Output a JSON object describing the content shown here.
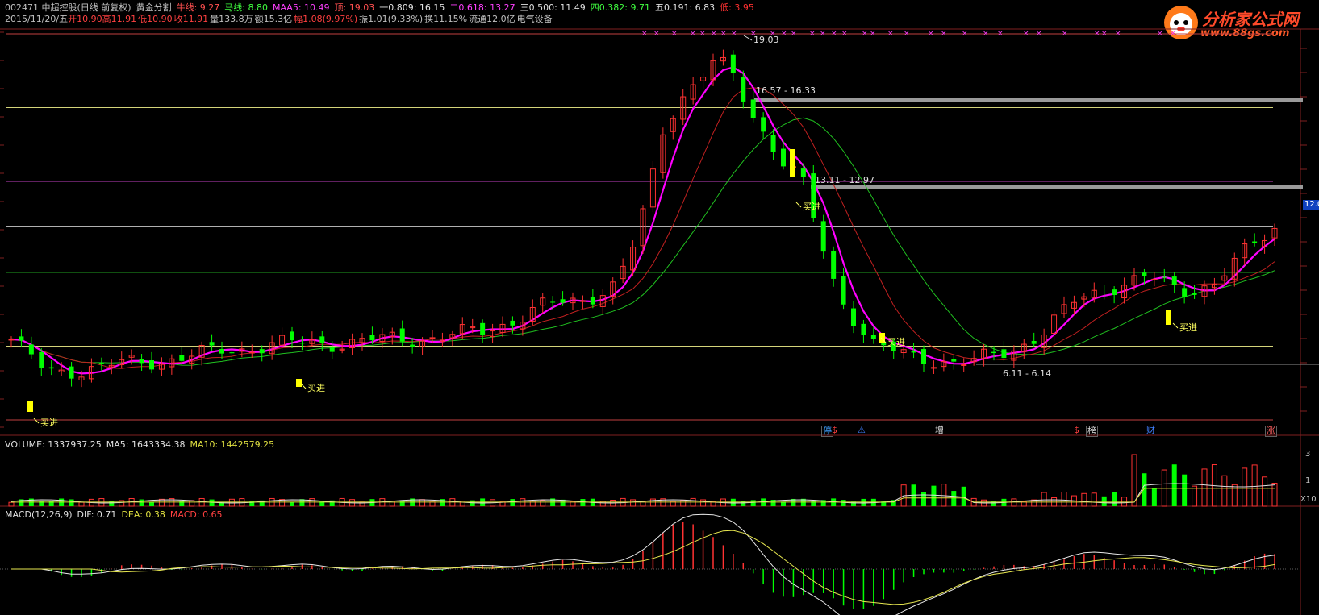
{
  "header": {
    "line1": {
      "code_name": "002471 中超控股(日线 前复权)",
      "indicator_name": "黄金分割",
      "niu_line": "牛线: 9.27",
      "ma_line": "马线: 8.80",
      "maa5": "MAA5: 10.49",
      "top": "顶: 19.03",
      "fib1": "一0.809: 16.15",
      "fib2": "二0.618: 13.27",
      "fib3": "三0.500: 11.49",
      "fib4": "四0.382: 9.71",
      "fib5": "五0.191: 6.83",
      "low": "低: 3.95"
    },
    "line2": {
      "date": "2015/11/20/五",
      "open": "开10.90",
      "high": "高11.91",
      "low": "低10.90",
      "close": "收11.91",
      "volume": "量133.8万",
      "amount": "额15.3亿",
      "change": "幅1.08(9.97%)",
      "amplitude": "振1.01(9.33%)",
      "turnover": "换11.15%",
      "float_cap": "流通12.0亿",
      "sector": "电气设备"
    }
  },
  "logo": {
    "name": "分析家公式网",
    "url": "www.88gs.com"
  },
  "price_tag": "12.0",
  "annotations": {
    "peak": "19.03",
    "zone1": "16.57 - 16.33",
    "zone2": "13.11 - 12.97",
    "zone3": "6.11 - 6.14",
    "buy_label": "买进"
  },
  "event_tags": [
    "停",
    "$",
    "⚠",
    "增",
    "$",
    "榜",
    "财",
    "涨"
  ],
  "volume_header": {
    "volume": "VOLUME: 1337937.25",
    "ma5": "MA5: 1643334.38",
    "ma10": "MA10: 1442579.25"
  },
  "volume_axis": {
    "top": "3",
    "mid": "1",
    "unit": "X10"
  },
  "macd_header": {
    "name": "MACD(12,26,9)",
    "dif": "DIF: 0.71",
    "dea": "DEA: 0.38",
    "macd": "MACD: 0.65"
  },
  "colors": {
    "up": "#ff3232",
    "down": "#00ff00",
    "ma_pink": "#ff00ff",
    "ma_red": "#c02020",
    "ma_green": "#20c020",
    "fib_yellow": "#d4d47a",
    "fib_pink": "#c040c0",
    "fib_white": "#b0b0b0",
    "fib_green": "#20a020",
    "highlight": "#ffff00"
  }
}
